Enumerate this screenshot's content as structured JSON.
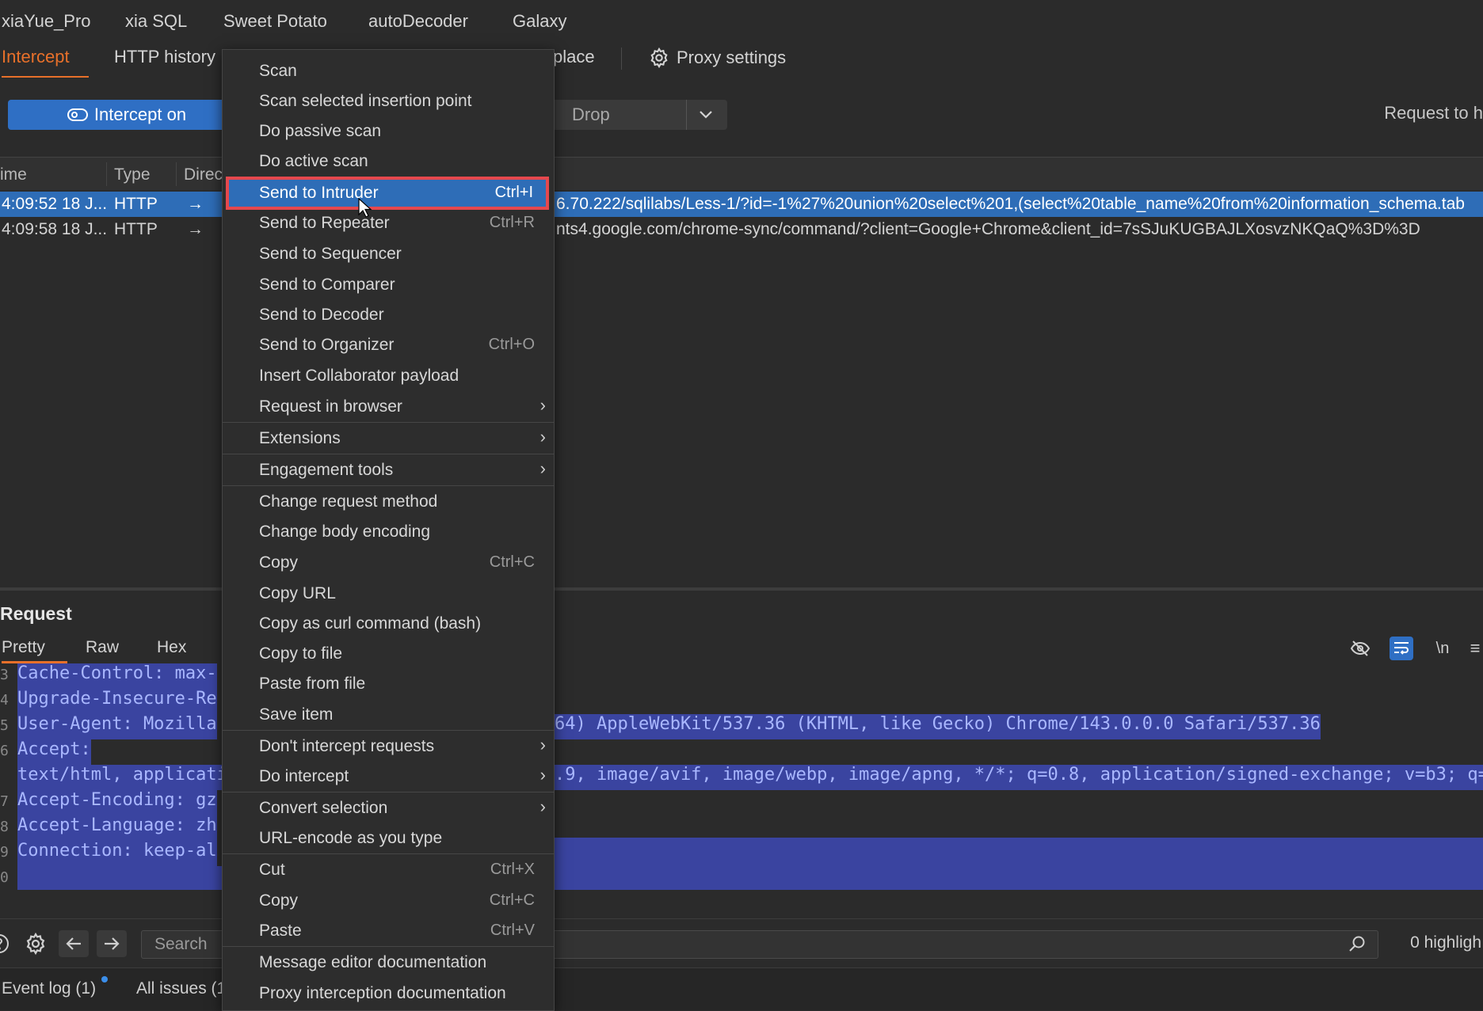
{
  "extension_tabs": [
    "xiaYue_Pro",
    "xia SQL",
    "Sweet Potato",
    "autoDecoder",
    "Galaxy"
  ],
  "proxy_tabs": {
    "intercept": "Intercept",
    "http_history": "HTTP history",
    "partial_place": "place",
    "proxy_settings": "Proxy settings"
  },
  "toolbar": {
    "intercept_toggle": "Intercept on",
    "drop": "Drop",
    "request_to": "Request to h"
  },
  "table": {
    "headers": [
      "ime",
      "Type",
      "Direc"
    ],
    "rows": [
      {
        "time": "4:09:52 18 J...",
        "type": "HTTP",
        "dir": "→",
        "url": "6.70.222/sqlilabs/Less-1/?id=-1%27%20union%20select%201,(select%20table_name%20from%20information_schema.tab"
      },
      {
        "time": "4:09:58 18 J...",
        "type": "HTTP",
        "dir": "→",
        "url": "nts4.google.com/chrome-sync/command/?client=Google+Chrome&client_id=7sSJuKUGBAJLXosvzNKQaQ%3D%3D"
      }
    ]
  },
  "request_panel": {
    "title": "Request",
    "tabs": [
      "Pretty",
      "Raw",
      "Hex"
    ],
    "lines_left": [
      "Cache-Control: max-",
      "Upgrade-Insecure-Re",
      "User-Agent: Mozilla",
      "Accept:",
      "text/html, applicati",
      "Accept-Encoding: gz",
      "Accept-Language: zh",
      "Connection: keep-al"
    ],
    "line_user_agent_right": "64) AppleWebKit/537.36 (KHTML, like Gecko) Chrome/143.0.0.0 Safari/537.36",
    "line_accept_right": ".9, image/avif, image/webp, image/apng, */*; q=0.8, application/signed-exchange; v=b3; q=0.7"
  },
  "bottom": {
    "search_placeholder": "Search",
    "highlights": "0 highligh",
    "event_log": "Event log (1)",
    "all_issues": "All issues (1"
  },
  "context_menu": {
    "items": [
      {
        "label": "Scan"
      },
      {
        "label": "Scan selected insertion point"
      },
      {
        "label": "Do passive scan"
      },
      {
        "label": "Do active scan"
      },
      {
        "label": "Send to Intruder",
        "shortcut": "Ctrl+I"
      },
      {
        "label": "Send to Repeater",
        "shortcut": "Ctrl+R"
      },
      {
        "label": "Send to Sequencer"
      },
      {
        "label": "Send to Comparer"
      },
      {
        "label": "Send to Decoder"
      },
      {
        "label": "Send to Organizer",
        "shortcut": "Ctrl+O"
      },
      {
        "label": "Insert Collaborator payload"
      },
      {
        "label": "Request in browser"
      },
      {
        "label": "Extensions"
      },
      {
        "label": "Engagement tools"
      },
      {
        "label": "Change request method"
      },
      {
        "label": "Change body encoding"
      },
      {
        "label": "Copy",
        "shortcut": "Ctrl+C"
      },
      {
        "label": "Copy URL"
      },
      {
        "label": "Copy as curl command (bash)"
      },
      {
        "label": "Copy to file"
      },
      {
        "label": "Paste from file"
      },
      {
        "label": "Save item"
      },
      {
        "label": "Don't intercept requests"
      },
      {
        "label": "Do intercept"
      },
      {
        "label": "Convert selection"
      },
      {
        "label": "URL-encode as you type"
      },
      {
        "label": "Cut",
        "shortcut": "Ctrl+X"
      },
      {
        "label": "Copy",
        "shortcut": "Ctrl+C"
      },
      {
        "label": "Paste",
        "shortcut": "Ctrl+V"
      },
      {
        "label": "Message editor documentation"
      },
      {
        "label": "Proxy interception documentation"
      }
    ]
  },
  "colors": {
    "accent_orange": "#e8702a",
    "selection_blue": "#2e6db7",
    "highlight_red": "#e5484d"
  }
}
